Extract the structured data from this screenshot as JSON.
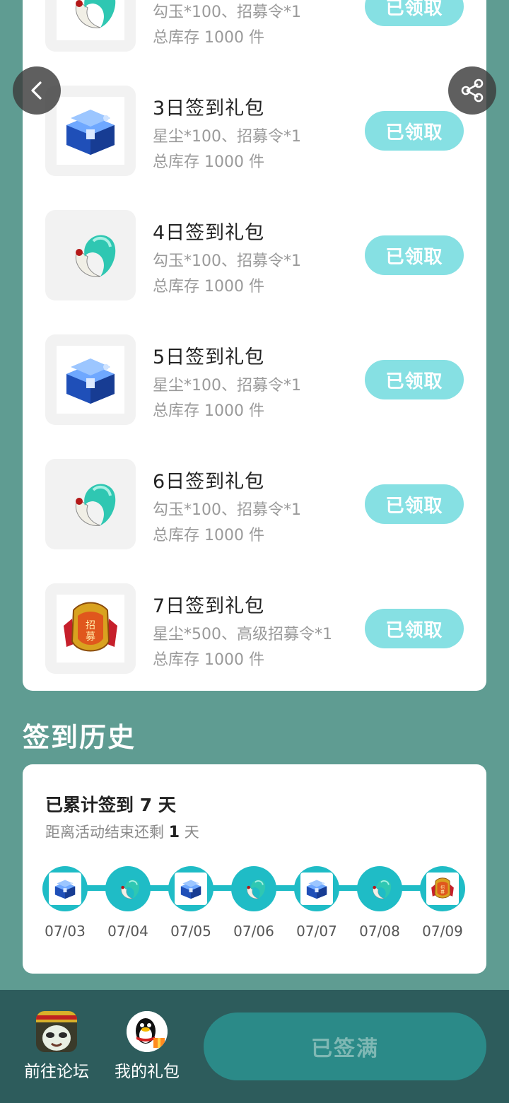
{
  "gifts": [
    {
      "name": "",
      "contents": "勾玉*100、招募令*1",
      "stock": "总库存 1000 件",
      "button": "已领取",
      "icon": "jade-magatama-icon"
    },
    {
      "name": "3日签到礼包",
      "contents": "星尘*100、招募令*1",
      "stock": "总库存 1000 件",
      "button": "已领取",
      "icon": "blue-chest-icon"
    },
    {
      "name": "4日签到礼包",
      "contents": "勾玉*100、招募令*1",
      "stock": "总库存 1000 件",
      "button": "已领取",
      "icon": "jade-magatama-icon"
    },
    {
      "name": "5日签到礼包",
      "contents": "星尘*100、招募令*1",
      "stock": "总库存 1000 件",
      "button": "已领取",
      "icon": "blue-chest-icon"
    },
    {
      "name": "6日签到礼包",
      "contents": "勾玉*100、招募令*1",
      "stock": "总库存 1000 件",
      "button": "已领取",
      "icon": "jade-magatama-icon"
    },
    {
      "name": "7日签到礼包",
      "contents": "星尘*500、高级招募令*1",
      "stock": "总库存 1000 件",
      "button": "已领取",
      "icon": "recruit-token-icon"
    }
  ],
  "history": {
    "title": "签到历史",
    "total_prefix": "已累计签到",
    "total_days": "7",
    "total_suffix": "天",
    "remain_prefix": "距离活动结束还剩",
    "remain_days": "1",
    "remain_suffix": "天",
    "dates": [
      {
        "date": "07/03",
        "icon": "blue-chest-icon"
      },
      {
        "date": "07/04",
        "icon": "jade-magatama-icon"
      },
      {
        "date": "07/05",
        "icon": "blue-chest-icon"
      },
      {
        "date": "07/06",
        "icon": "jade-magatama-icon"
      },
      {
        "date": "07/07",
        "icon": "blue-chest-icon"
      },
      {
        "date": "07/08",
        "icon": "jade-magatama-icon"
      },
      {
        "date": "07/09",
        "icon": "recruit-token-icon"
      }
    ]
  },
  "bottom": {
    "forum_label": "前往论坛",
    "gifts_label": "我的礼包",
    "signed_label": "已签满"
  },
  "colors": {
    "page_bg": "#5f9c92",
    "claim_button": "#86e0e3",
    "timeline": "#1fbcc6",
    "bottom_bar": "#2d5c5c",
    "signed_button": "#2b8a88"
  }
}
